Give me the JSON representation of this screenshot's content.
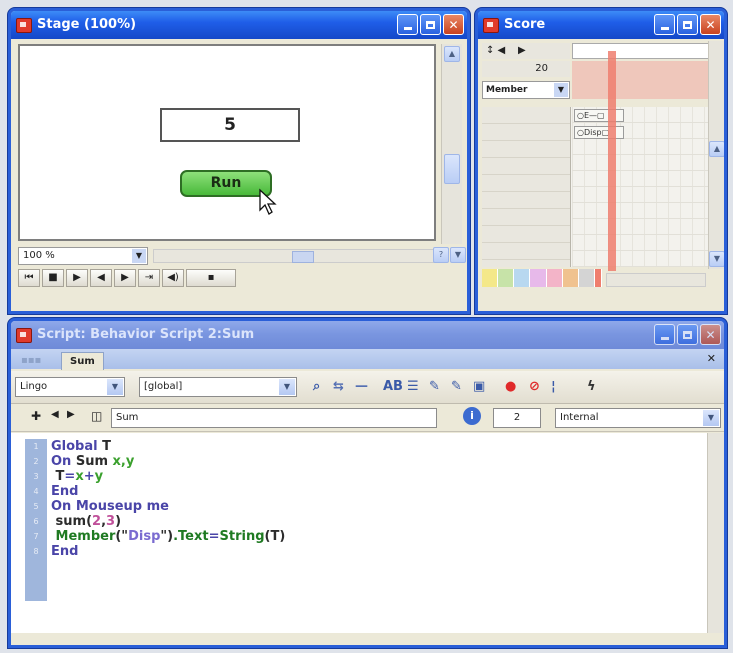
{
  "stage": {
    "title": "Stage (100%)",
    "field_value": "5",
    "run_label": "Run",
    "zoom": "100 %",
    "controls": [
      "⏮",
      "■",
      "▶",
      "◀",
      "▶",
      "⇥",
      "◀)",
      "▪"
    ]
  },
  "score": {
    "title": "Score",
    "row_header": "Member",
    "frame_number": "20",
    "sprites": [
      "E",
      "Disp"
    ]
  },
  "script": {
    "title": "Script: Behavior Script 2:Sum",
    "tabs": [
      "Sum"
    ],
    "language": "Lingo",
    "scope": "[global]",
    "member_name": "Sum",
    "cast_number": "2",
    "cast": "Internal",
    "code_lines": [
      [
        {
          "t": "Global ",
          "c": "kw"
        },
        {
          "t": "T",
          "c": "id"
        }
      ],
      [
        {
          "t": "On ",
          "c": "kw"
        },
        {
          "t": "Sum ",
          "c": "id"
        },
        {
          "t": "x,y",
          "c": "arg"
        }
      ],
      [
        {
          "t": " T",
          "c": "id"
        },
        {
          "t": "=",
          "c": "kw"
        },
        {
          "t": "x",
          "c": "arg"
        },
        {
          "t": "+",
          "c": "kw"
        },
        {
          "t": "y",
          "c": "arg"
        }
      ],
      [
        {
          "t": "End",
          "c": "kw"
        }
      ],
      [
        {
          "t": "On ",
          "c": "kw"
        },
        {
          "t": "Mouseup ",
          "c": "kw"
        },
        {
          "t": "me",
          "c": "kw"
        }
      ],
      [
        {
          "t": " sum",
          "c": "id"
        },
        {
          "t": "(",
          "c": "id"
        },
        {
          "t": "2",
          "c": "num"
        },
        {
          "t": ",",
          "c": "id"
        },
        {
          "t": "3",
          "c": "num"
        },
        {
          "t": ")",
          "c": "id"
        }
      ],
      [
        {
          "t": " Member",
          "c": "fn"
        },
        {
          "t": "(\"",
          "c": "id"
        },
        {
          "t": "Disp",
          "c": "str"
        },
        {
          "t": "\")",
          "c": "id"
        },
        {
          "t": ".Text",
          "c": "fn"
        },
        {
          "t": "=",
          "c": "kw"
        },
        {
          "t": "String",
          "c": "fn"
        },
        {
          "t": "(T)",
          "c": "id"
        }
      ],
      [
        {
          "t": "End",
          "c": "kw"
        }
      ]
    ]
  }
}
